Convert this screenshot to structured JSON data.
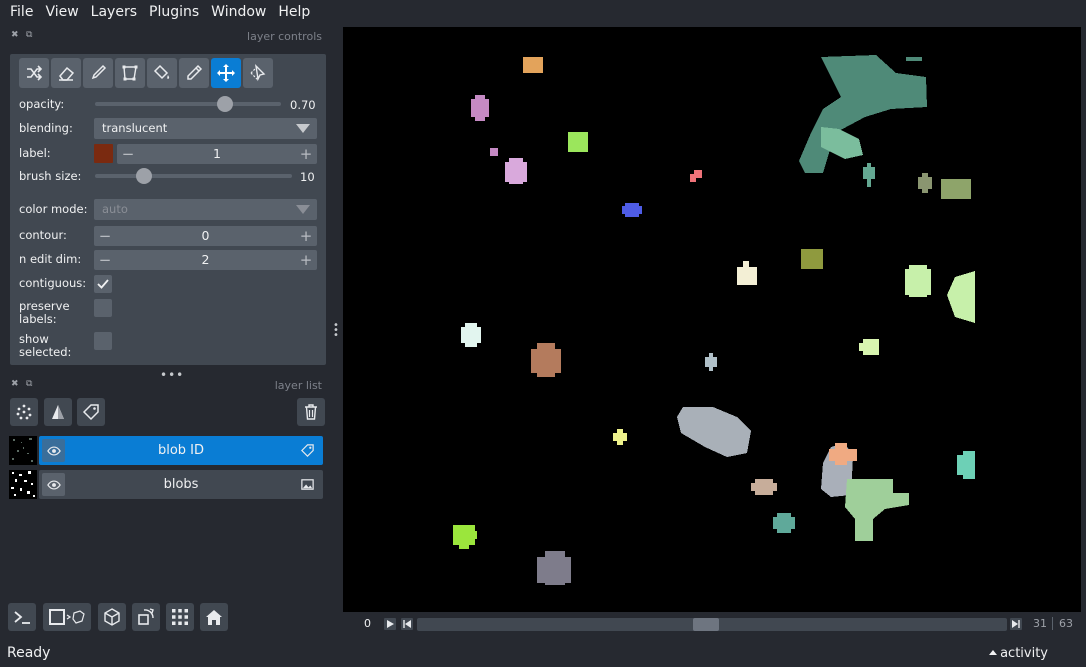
{
  "menu": [
    "File",
    "View",
    "Layers",
    "Plugins",
    "Window",
    "Help"
  ],
  "layer_controls": {
    "title": "layer controls",
    "tools": [
      "shuffle-colors",
      "erase",
      "paint",
      "polygon",
      "fill",
      "pick",
      "pan-zoom",
      "transform"
    ],
    "active_tool": "pan-zoom",
    "opacity": {
      "label": "opacity:",
      "value": 0.7,
      "display": "0.70"
    },
    "blending": {
      "label": "blending:",
      "value": "translucent"
    },
    "label": {
      "label": "label:",
      "value": "1",
      "swatch_color": "#7a2a10"
    },
    "brush_size": {
      "label": "brush size:",
      "value": 10,
      "max": 40,
      "display": "10"
    },
    "color_mode": {
      "label": "color mode:",
      "value": "auto"
    },
    "contour": {
      "label": "contour:",
      "value": "0"
    },
    "n_edit_dim": {
      "label": "n edit dim:",
      "value": "2"
    },
    "contiguous": {
      "label": "contiguous:",
      "checked": true
    },
    "preserve_labels": {
      "label": "preserve\nlabels:",
      "checked": false
    },
    "show_selected": {
      "label": "show\nselected:",
      "checked": false
    }
  },
  "layer_list": {
    "title": "layer list",
    "buttons": [
      "new-points",
      "new-shapes",
      "new-labels"
    ],
    "layers": [
      {
        "name": "blob ID",
        "type": "labels",
        "selected": true
      },
      {
        "name": "blobs",
        "type": "image",
        "selected": false
      }
    ]
  },
  "viewer_buttons": [
    "console",
    "ndisplay-toggle",
    "roll",
    "transpose",
    "grid",
    "home"
  ],
  "dims": {
    "axis": "0",
    "current": "31",
    "max": "63",
    "fraction": 0.49
  },
  "status": {
    "message": "Ready",
    "activity": "activity"
  },
  "colors": {
    "accent": "#0a7dd4",
    "panel": "#414851",
    "background": "#262930",
    "button": "#5a626c"
  }
}
